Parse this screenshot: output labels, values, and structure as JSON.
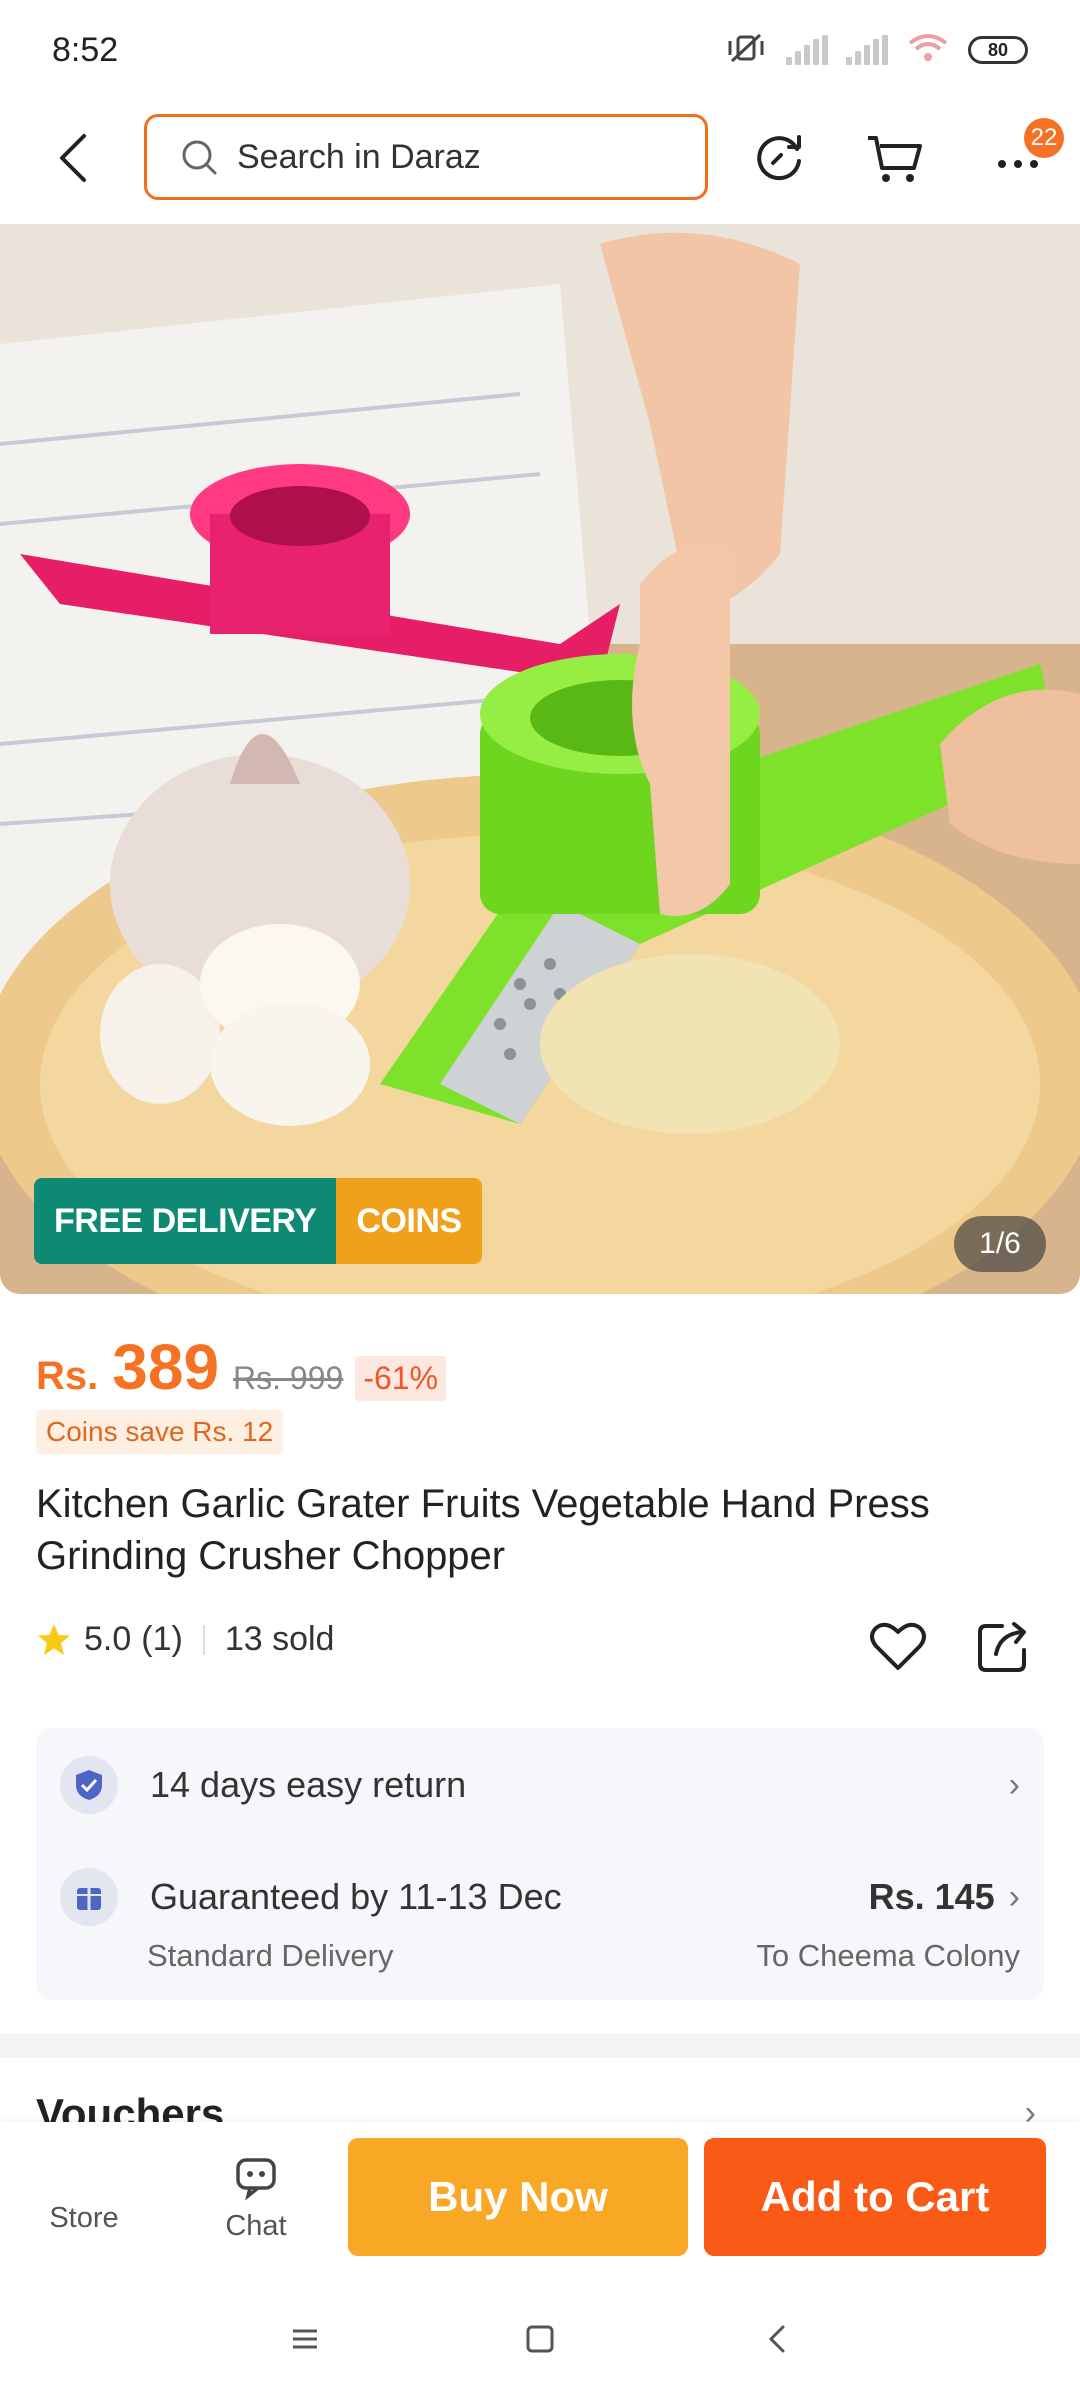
{
  "status_bar": {
    "time": "8:52",
    "battery": "80"
  },
  "search": {
    "placeholder": "Search in Daraz"
  },
  "nav": {
    "cart_badge": "22"
  },
  "hero": {
    "promo_free_delivery": "FREE DELIVERY",
    "promo_coins": "COINS",
    "image_counter": "1/6"
  },
  "price": {
    "currency": "Rs.",
    "amount": "389",
    "original": "Rs. 999",
    "discount": "-61%",
    "coins_save": "Coins save Rs. 12"
  },
  "product": {
    "title": "Kitchen Garlic Grater Fruits Vegetable Hand Press Grinding Crusher Chopper",
    "rating": "5.0",
    "review_count": "(1)",
    "sold": "13 sold"
  },
  "info": {
    "return_text": "14 days easy return",
    "delivery_guarantee": "Guaranteed by 11-13 Dec",
    "delivery_type": "Standard Delivery",
    "delivery_fee": "Rs. 145",
    "delivery_location": "To Cheema Colony"
  },
  "section": {
    "vouchers": "Vouchers"
  },
  "action_bar": {
    "store": "Store",
    "chat": "Chat",
    "buy_now": "Buy Now",
    "add_to_cart": "Add to Cart"
  },
  "colors": {
    "accent": "#f57224",
    "buy_now": "#f9a825",
    "add_to_cart": "#f95a15",
    "promo_green": "#0e8a74",
    "promo_gold": "#efa11b"
  }
}
